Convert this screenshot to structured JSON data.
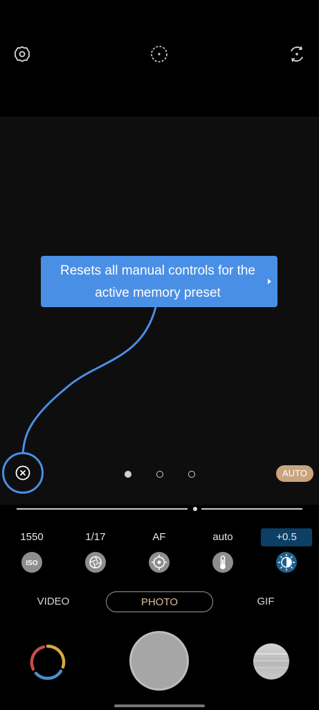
{
  "top_bar": {
    "settings_icon": "gear-icon",
    "focus_icon": "focus-circle-icon",
    "switch_camera_icon": "rotate-camera-icon"
  },
  "tooltip": {
    "line1": "Resets all manual controls for the",
    "line2": "active memory preset",
    "color": "#4a8fe6"
  },
  "reset_button": {
    "icon": "close-circle-icon"
  },
  "pager": {
    "count": 3,
    "active_index": 0
  },
  "auto_badge": {
    "label": "AUTO",
    "color": "#c8a47f"
  },
  "controls": [
    {
      "value": "1550",
      "icon": "iso-icon"
    },
    {
      "value": "1/17",
      "icon": "shutter-aperture-icon"
    },
    {
      "value": "AF",
      "icon": "focus-target-icon"
    },
    {
      "value": "auto",
      "icon": "thermometer-icon"
    },
    {
      "value": "+0.5",
      "icon": "exposure-icon",
      "active": true
    }
  ],
  "modes": [
    {
      "label": "VIDEO"
    },
    {
      "label": "PHOTO",
      "selected": true
    },
    {
      "label": "GIF"
    }
  ],
  "colors": {
    "accent_blue": "#4a8fe6",
    "active_control_bg": "#0b3f66"
  }
}
